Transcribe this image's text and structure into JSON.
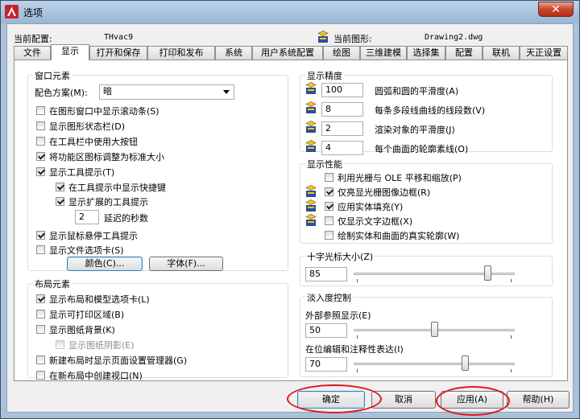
{
  "title": "选项",
  "profile": {
    "label": "当前配置:",
    "value": "THvac9"
  },
  "drawing": {
    "label": "当前图形:",
    "value": "Drawing2.dwg"
  },
  "tabs": [
    "文件",
    "显示",
    "打开和保存",
    "打印和发布",
    "系统",
    "用户系统配置",
    "绘图",
    "三维建模",
    "选择集",
    "配置",
    "联机",
    "天正设置"
  ],
  "window_elements": {
    "title": "窗口元素",
    "color_scheme_label": "配色方案(M):",
    "color_scheme_value": "暗",
    "checks": [
      {
        "label": "在图形窗口中显示滚动条(S)",
        "checked": false
      },
      {
        "label": "显示图形状态栏(D)",
        "checked": false
      },
      {
        "label": "在工具栏中使用大按钮",
        "checked": false
      },
      {
        "label": "将功能区图标调整为标准大小",
        "checked": true
      },
      {
        "label": "显示工具提示(T)",
        "checked": true
      },
      {
        "label": "在工具提示中显示快捷键",
        "checked": true
      },
      {
        "label": "显示扩展的工具提示",
        "checked": true
      }
    ],
    "delay_value": "2",
    "delay_label": "延迟的秒数",
    "checks2": [
      {
        "label": "显示鼠标悬停工具提示",
        "checked": true
      },
      {
        "label": "显示文件选项卡(S)",
        "checked": false
      }
    ],
    "colors_button": "颜色(C)...",
    "fonts_button": "字体(F)..."
  },
  "layout_elements": {
    "title": "布局元素",
    "checks": [
      {
        "label": "显示布局和模型选项卡(L)",
        "checked": true
      },
      {
        "label": "显示可打印区域(B)",
        "checked": false
      },
      {
        "label": "显示图纸背景(K)",
        "checked": false
      },
      {
        "label": "显示图纸阴影(E)",
        "checked": false,
        "disabled": true
      },
      {
        "label": "新建布局时显示页面设置管理器(G)",
        "checked": false
      },
      {
        "label": "在新布局中创建视口(N)",
        "checked": false
      }
    ]
  },
  "resolution": {
    "title": "显示精度",
    "rows": [
      {
        "value": "100",
        "label": "圆弧和圆的平滑度(A)"
      },
      {
        "value": "8",
        "label": "每条多段线曲线的线段数(V)"
      },
      {
        "value": "2",
        "label": "渲染对象的平滑度(J)"
      },
      {
        "value": "4",
        "label": "每个曲面的轮廓素线(O)"
      }
    ]
  },
  "performance": {
    "title": "显示性能",
    "checks": [
      {
        "label": "利用光栅与 OLE 平移和缩放(P)",
        "checked": false
      },
      {
        "label": "仅亮显光栅图像边框(R)",
        "checked": true
      },
      {
        "label": "应用实体填充(Y)",
        "checked": true
      },
      {
        "label": "仅显示文字边框(X)",
        "checked": false
      },
      {
        "label": "绘制实体和曲面的真实轮廓(W)",
        "checked": false
      }
    ]
  },
  "crosshair": {
    "title": "十字光标大小(Z)",
    "value": "85",
    "level": 85
  },
  "fade": {
    "title": "淡入度控制",
    "xref_label": "外部参照显示(E)",
    "xref_value": "50",
    "xref_level": 50,
    "inplace_label": "在位编辑和注释性表达(I)",
    "inplace_value": "70",
    "inplace_level": 70
  },
  "buttons": {
    "ok": "确定",
    "cancel": "取消",
    "apply": "应用(A)",
    "help": "帮助(H)"
  },
  "colors": {
    "highlight_circle": "#e0161b",
    "titlebar": "#a9c2da",
    "close": "#c7442a"
  }
}
